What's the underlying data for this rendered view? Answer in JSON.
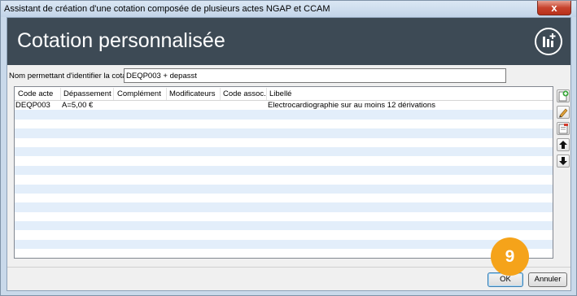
{
  "window": {
    "title": "Assistant de création d'une cotation composée de plusieurs actes NGAP et CCAM",
    "close_label": "x"
  },
  "header": {
    "title": "Cotation personnalisée",
    "logo_icon": "logo-icon"
  },
  "name_field": {
    "label": "Nom permettant d'identifier la cotation :",
    "value": "DEQP003 + depasst"
  },
  "table": {
    "columns": [
      "Code acte",
      "Dépassement",
      "Complément",
      "Modificateurs",
      "Code assoc.",
      "Libellé"
    ],
    "rows": [
      {
        "code_acte": "DEQP003",
        "depassement": "A=5,00 €",
        "complement": "",
        "modificateurs": "",
        "code_assoc": "",
        "libelle": "Electrocardiographie sur au moins 12 dérivations"
      }
    ]
  },
  "side_tools": [
    "add-icon",
    "edit-icon",
    "delete-icon",
    "arrow-up-icon",
    "arrow-down-icon"
  ],
  "buttons": {
    "ok": "OK",
    "cancel": "Annuler"
  },
  "badge": {
    "number": "9"
  },
  "colors": {
    "header_bg": "#3d4a55",
    "row_alt": "#e3eefa",
    "badge": "#f5a31a",
    "close": "#c7432d"
  }
}
